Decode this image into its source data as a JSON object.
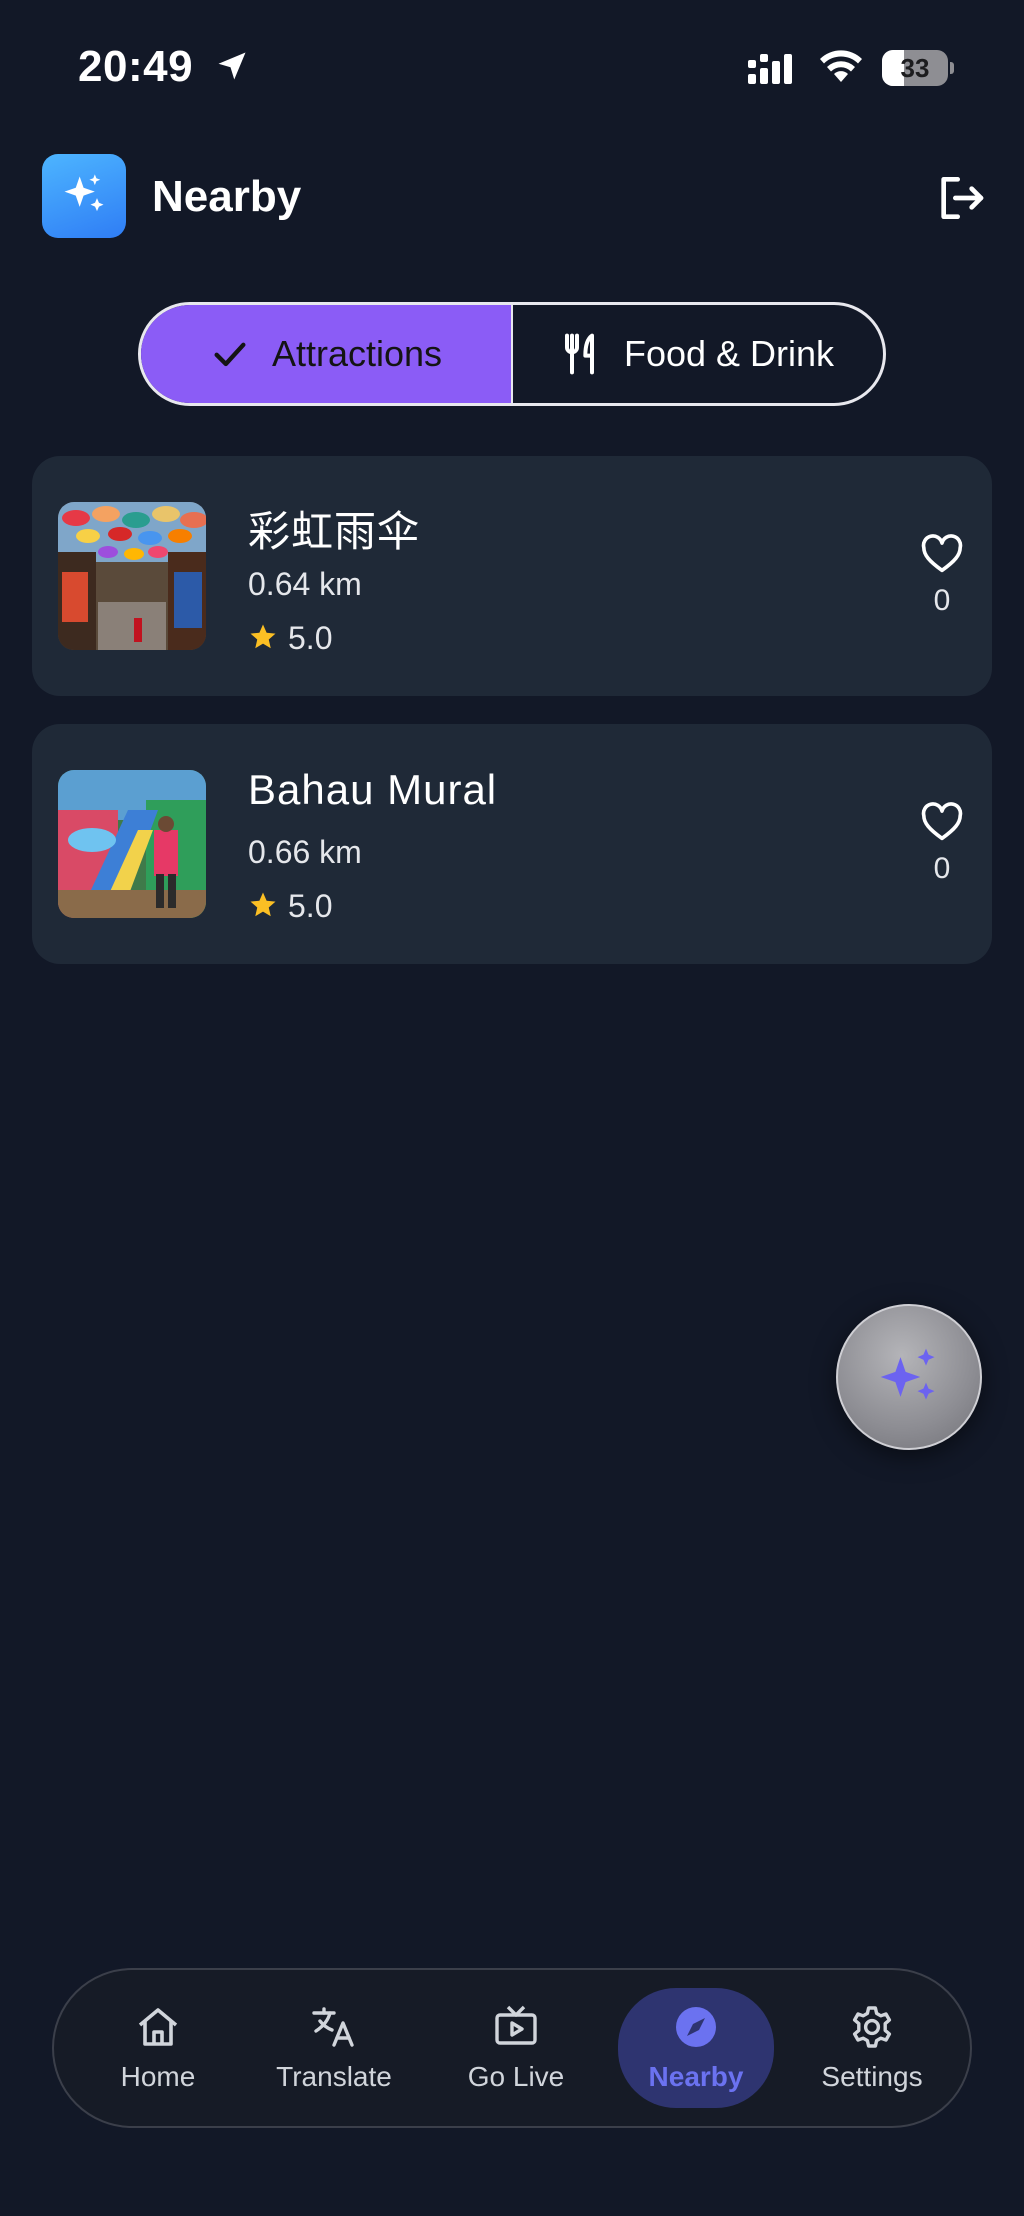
{
  "status_bar": {
    "time": "20:49",
    "battery": "33"
  },
  "header": {
    "title": "Nearby"
  },
  "tabs": [
    {
      "label": "Attractions",
      "active": true
    },
    {
      "label": "Food & Drink",
      "active": false
    }
  ],
  "places": [
    {
      "name": "彩虹雨伞",
      "distance": "0.64 km",
      "rating": "5.0",
      "likes": "0"
    },
    {
      "name": "Bahau Mural",
      "distance": "0.66 km",
      "rating": "5.0",
      "likes": "0"
    }
  ],
  "bottom_nav": [
    {
      "label": "Home",
      "icon": "home-icon"
    },
    {
      "label": "Translate",
      "icon": "translate-icon"
    },
    {
      "label": "Go Live",
      "icon": "tv-play-icon"
    },
    {
      "label": "Nearby",
      "icon": "compass-icon",
      "active": true
    },
    {
      "label": "Settings",
      "icon": "gear-icon"
    }
  ],
  "colors": {
    "background": "#121827",
    "card": "#1f2937",
    "accent": "#8b5cf6",
    "nav_active": "#6b72f0",
    "star": "#fbbf24"
  }
}
